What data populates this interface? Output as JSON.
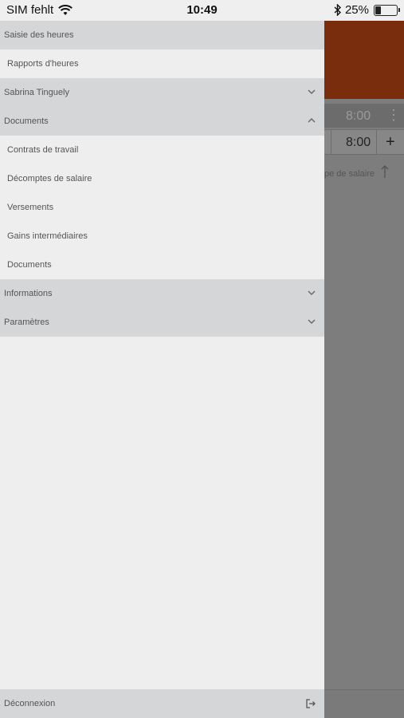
{
  "status_bar": {
    "carrier": "SIM fehlt",
    "time": "10:49",
    "battery": "25%",
    "battery_level": 0.25
  },
  "menu": {
    "timesheet": "Saisie des heures",
    "reports": "Rapports d'heures",
    "user": "Sabrina Tinguely",
    "documents_section": "Documents",
    "documents_items": [
      "Contrats de travail",
      "Décomptes de salaire",
      "Versements",
      "Gains intermédiaires",
      "Documents"
    ],
    "information": "Informations",
    "settings": "Paramètres",
    "logout": "Déconnexion"
  },
  "background": {
    "row1_value": "8:00",
    "row2_value": "8:00",
    "plus": "+",
    "doc_label": "pe de salaire"
  },
  "colors": {
    "header": "#7a2d0c",
    "section_bg": "#d4d6d8",
    "drawer_bg": "#eeeeee"
  }
}
